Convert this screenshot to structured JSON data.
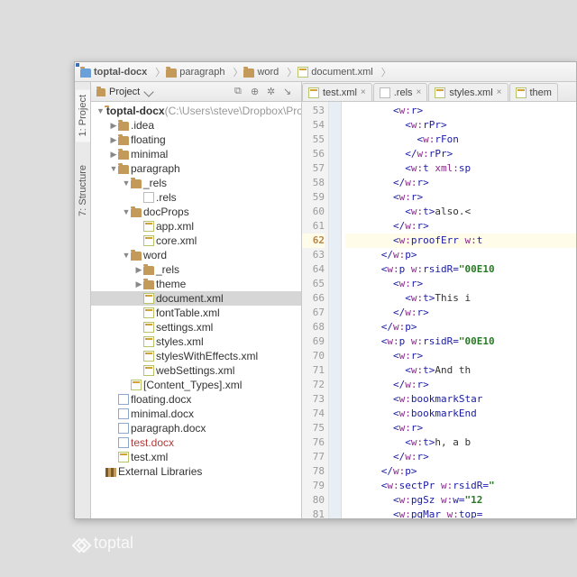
{
  "breadcrumb": [
    "toptal-docx",
    "paragraph",
    "word",
    "document.xml"
  ],
  "sidetabs": {
    "project": "1: Project",
    "structure": "7: Structure"
  },
  "project_header": {
    "label": "Project",
    "view": "▾"
  },
  "tree": [
    {
      "d": 0,
      "k": "root",
      "open": 1,
      "bold": 1,
      "label": "toptal-docx",
      "path": " (C:\\Users\\steve\\Dropbox\\Projects\\topt"
    },
    {
      "d": 1,
      "k": "folder",
      "open": 0,
      "label": ".idea"
    },
    {
      "d": 1,
      "k": "folder",
      "open": 0,
      "label": "floating"
    },
    {
      "d": 1,
      "k": "folder",
      "open": 0,
      "label": "minimal"
    },
    {
      "d": 1,
      "k": "folder",
      "open": 1,
      "label": "paragraph"
    },
    {
      "d": 2,
      "k": "folder",
      "open": 1,
      "label": "_rels"
    },
    {
      "d": 3,
      "k": "text",
      "label": ".rels"
    },
    {
      "d": 2,
      "k": "folder",
      "open": 1,
      "label": "docProps"
    },
    {
      "d": 3,
      "k": "xml",
      "label": "app.xml"
    },
    {
      "d": 3,
      "k": "xml",
      "label": "core.xml"
    },
    {
      "d": 2,
      "k": "folder",
      "open": 1,
      "label": "word"
    },
    {
      "d": 3,
      "k": "folder",
      "open": 0,
      "label": "_rels"
    },
    {
      "d": 3,
      "k": "folder",
      "open": 0,
      "label": "theme"
    },
    {
      "d": 3,
      "k": "xml",
      "sel": 1,
      "label": "document.xml"
    },
    {
      "d": 3,
      "k": "xml",
      "label": "fontTable.xml"
    },
    {
      "d": 3,
      "k": "xml",
      "label": "settings.xml"
    },
    {
      "d": 3,
      "k": "xml",
      "label": "styles.xml"
    },
    {
      "d": 3,
      "k": "xml",
      "label": "stylesWithEffects.xml"
    },
    {
      "d": 3,
      "k": "xml",
      "label": "webSettings.xml"
    },
    {
      "d": 2,
      "k": "xml",
      "label": "[Content_Types].xml"
    },
    {
      "d": 1,
      "k": "doc",
      "label": "floating.docx"
    },
    {
      "d": 1,
      "k": "doc",
      "label": "minimal.docx"
    },
    {
      "d": 1,
      "k": "doc",
      "label": "paragraph.docx"
    },
    {
      "d": 1,
      "k": "doc",
      "red": 1,
      "label": "test.docx"
    },
    {
      "d": 1,
      "k": "xml",
      "label": "test.xml"
    },
    {
      "d": 0,
      "k": "lib",
      "label": "External Libraries"
    }
  ],
  "editor_tabs": [
    "test.xml",
    ".rels",
    "styles.xml",
    "them"
  ],
  "code": {
    "start": 53,
    "highlight": 62,
    "lines": [
      [
        8,
        "<",
        "w:",
        "r",
        ">"
      ],
      [
        10,
        "<",
        "w:",
        "rPr",
        ">"
      ],
      [
        12,
        "<",
        "w:",
        "rFon"
      ],
      [
        10,
        "</",
        "w:",
        "rPr",
        ">"
      ],
      [
        10,
        "<",
        "w:",
        "t",
        " xml:",
        "sp"
      ],
      [
        8,
        "</",
        "w:",
        "r",
        ">"
      ],
      [
        8,
        "<",
        "w:",
        "r",
        ">"
      ],
      [
        10,
        "<",
        "w:",
        "t",
        ">",
        "txt:also.<"
      ],
      [
        8,
        "</",
        "w:",
        "r",
        ">"
      ],
      [
        8,
        "<",
        "w:",
        "proofErr",
        " w:",
        "t"
      ],
      [
        6,
        "</",
        "w:",
        "p",
        ">"
      ],
      [
        6,
        "<",
        "w:",
        "p",
        " w:",
        "rsidR",
        "=",
        "\"00E10"
      ],
      [
        8,
        "<",
        "w:",
        "r",
        ">"
      ],
      [
        10,
        "<",
        "w:",
        "t",
        ">",
        "txt:This i"
      ],
      [
        8,
        "</",
        "w:",
        "r",
        ">"
      ],
      [
        6,
        "</",
        "w:",
        "p",
        ">"
      ],
      [
        6,
        "<",
        "w:",
        "p",
        " w:",
        "rsidR",
        "=",
        "\"00E10"
      ],
      [
        8,
        "<",
        "w:",
        "r",
        ">"
      ],
      [
        10,
        "<",
        "w:",
        "t",
        ">",
        "txt:And th"
      ],
      [
        8,
        "</",
        "w:",
        "r",
        ">"
      ],
      [
        8,
        "<",
        "w:",
        "bookmarkStar"
      ],
      [
        8,
        "<",
        "w:",
        "bookmarkEnd"
      ],
      [
        8,
        "<",
        "w:",
        "r",
        ">"
      ],
      [
        10,
        "<",
        "w:",
        "t",
        ">",
        "txt:h, a b"
      ],
      [
        8,
        "</",
        "w:",
        "r",
        ">"
      ],
      [
        6,
        "</",
        "w:",
        "p",
        ">"
      ],
      [
        6,
        "<",
        "w:",
        "sectPr",
        " w:",
        "rsidR",
        "=",
        "\""
      ],
      [
        8,
        "<",
        "w:",
        "pgSz",
        " w:",
        "w",
        "=",
        "\"12"
      ],
      [
        8,
        "<",
        "w:",
        "pgMar",
        " w:",
        "top",
        "="
      ]
    ]
  },
  "brand": "toptal"
}
